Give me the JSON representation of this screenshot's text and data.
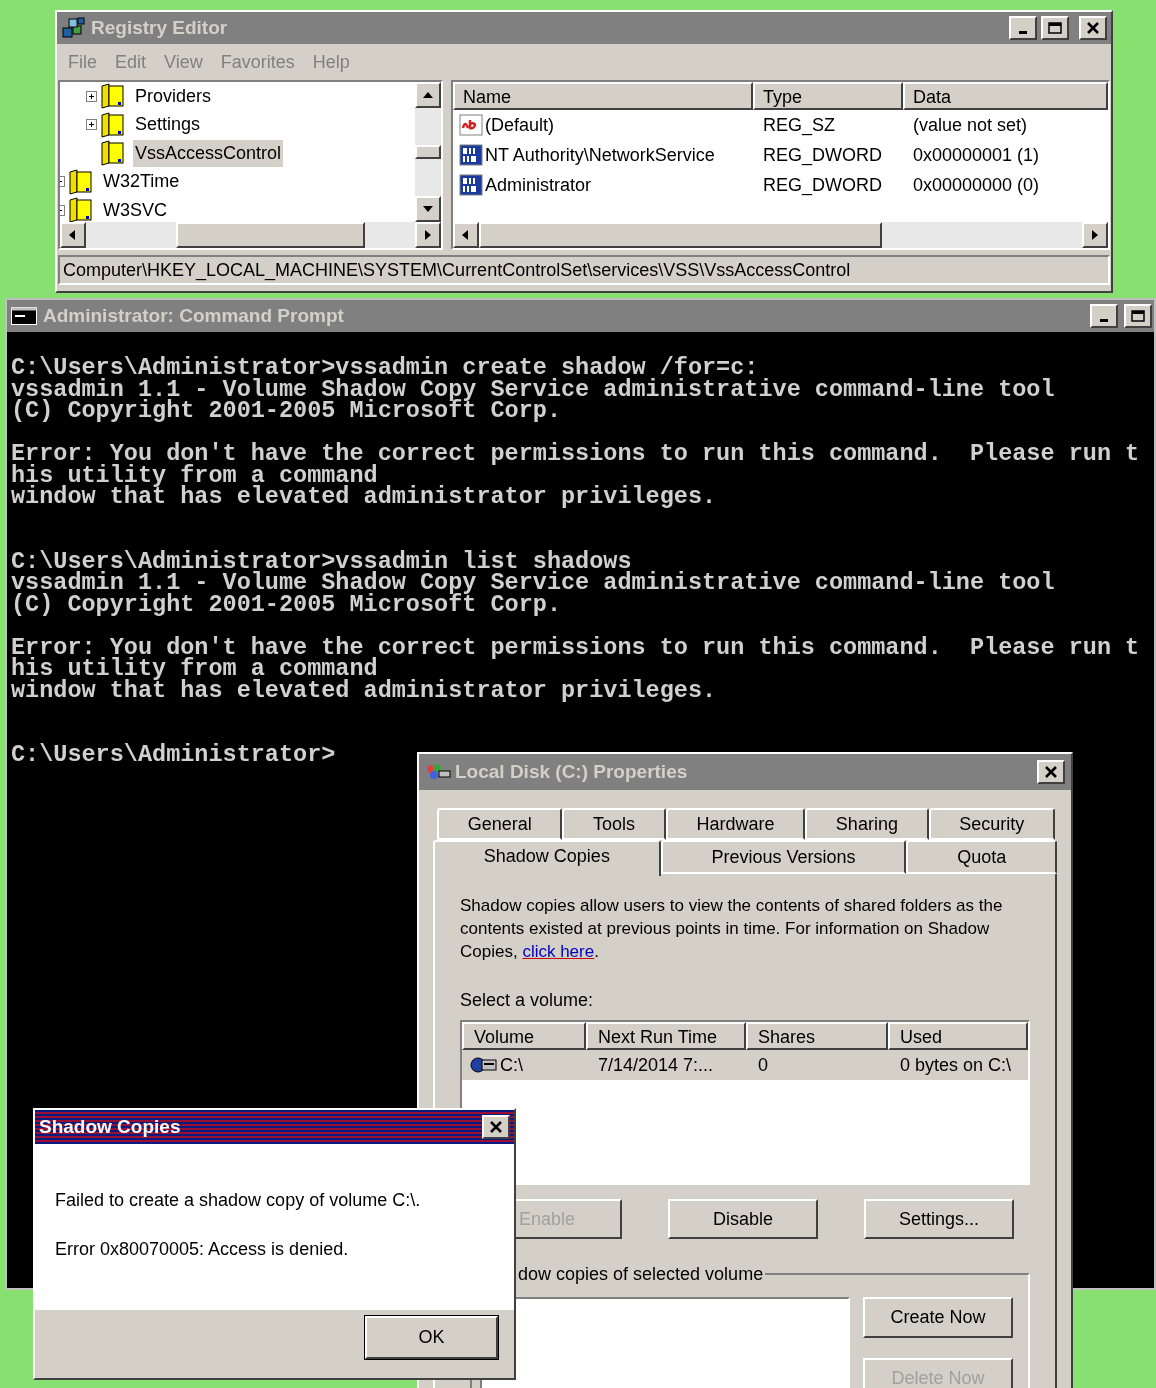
{
  "registry_editor": {
    "title": "Registry Editor",
    "active": false,
    "menu": [
      "File",
      "Edit",
      "View",
      "Favorites",
      "Help"
    ],
    "tree": {
      "scrolled_branch": [
        {
          "label": "Providers",
          "expandable": true,
          "selected": false
        },
        {
          "label": "Settings",
          "expandable": true,
          "selected": false
        },
        {
          "label": "VssAccessControl",
          "expandable": false,
          "selected": true
        }
      ],
      "items": [
        {
          "label": "W32Time",
          "expandable": true,
          "selected": false
        },
        {
          "label": "W3SVC",
          "expandable": true,
          "selected": false
        }
      ]
    },
    "values": {
      "columns": [
        "Name",
        "Type",
        "Data"
      ],
      "rows": [
        {
          "kind": "string",
          "name": "(Default)",
          "type": "REG_SZ",
          "data": "(value not set)"
        },
        {
          "kind": "dword",
          "name": "NT Authority\\NetworkService",
          "type": "REG_DWORD",
          "data": "0x00000001 (1)"
        },
        {
          "kind": "dword",
          "name": "Administrator",
          "type": "REG_DWORD",
          "data": "0x00000000 (0)"
        }
      ]
    },
    "status_bar": "Computer\\HKEY_LOCAL_MACHINE\\SYSTEM\\CurrentControlSet\\services\\VSS\\VssAccessControl"
  },
  "command_prompt": {
    "title": "Administrator: Command Prompt",
    "active": false,
    "blocks": [
      {
        "kind": "prompt",
        "lines": [
          "C:\\Users\\Administrator>vssadmin create shadow /for=c:",
          "vssadmin 1.1 - Volume Shadow Copy Service administrative command-line tool",
          "(C) Copyright 2001-2005 Microsoft Corp."
        ]
      },
      {
        "kind": "output",
        "lines": [
          "Error: You don't have the correct permissions to run this command.  Please run t",
          "his utility from a command",
          "window that has elevated administrator privileges."
        ]
      },
      {
        "kind": "prompt",
        "lines": [
          "C:\\Users\\Administrator>vssadmin list shadows",
          "vssadmin 1.1 - Volume Shadow Copy Service administrative command-line tool",
          "(C) Copyright 2001-2005 Microsoft Corp."
        ]
      },
      {
        "kind": "output",
        "lines": [
          "Error: You don't have the correct permissions to run this command.  Please run t",
          "his utility from a command",
          "window that has elevated administrator privileges."
        ]
      },
      {
        "kind": "prompt",
        "lines": [
          "C:\\Users\\Administrator>"
        ]
      }
    ]
  },
  "properties": {
    "title": "Local Disk (C:) Properties",
    "active": false,
    "tab_rows": [
      [
        {
          "label": "General",
          "selected": false
        },
        {
          "label": "Tools",
          "selected": false
        },
        {
          "label": "Hardware",
          "selected": false
        },
        {
          "label": "Sharing",
          "selected": false
        },
        {
          "label": "Security",
          "selected": false
        }
      ],
      [
        {
          "label": "Shadow Copies",
          "selected": true
        },
        {
          "label": "Previous Versions",
          "selected": false
        },
        {
          "label": "Quota",
          "selected": false
        }
      ]
    ],
    "description": {
      "text": "Shadow copies allow users to view the contents of shared folders as the contents existed at previous points in time. For information on Shadow Copies, ",
      "link": "click here",
      "after": "."
    },
    "volume_label": "Select a volume:",
    "volumes": {
      "columns": [
        "Volume",
        "Next Run Time",
        "Shares",
        "Used"
      ],
      "rows": [
        {
          "selected": true,
          "cells": [
            "C:\\",
            "7/14/2014 7:...",
            "0",
            "0 bytes on C:\\"
          ]
        }
      ]
    },
    "buttons": [
      {
        "label": "Enable",
        "disabled": true
      },
      {
        "label": "Disable",
        "disabled": false
      },
      {
        "label": "Settings...",
        "disabled": false
      }
    ],
    "group_label": "dow copies of selected volume",
    "group_buttons": [
      {
        "label": "Create Now",
        "disabled": false
      },
      {
        "label": "Delete Now",
        "disabled": true
      }
    ]
  },
  "message_box": {
    "title": "Shadow Copies",
    "active": true,
    "lines": [
      "Failed to create a shadow copy of volume C:\\.",
      "Error 0x80070005: Access is denied."
    ],
    "button": "OK"
  }
}
